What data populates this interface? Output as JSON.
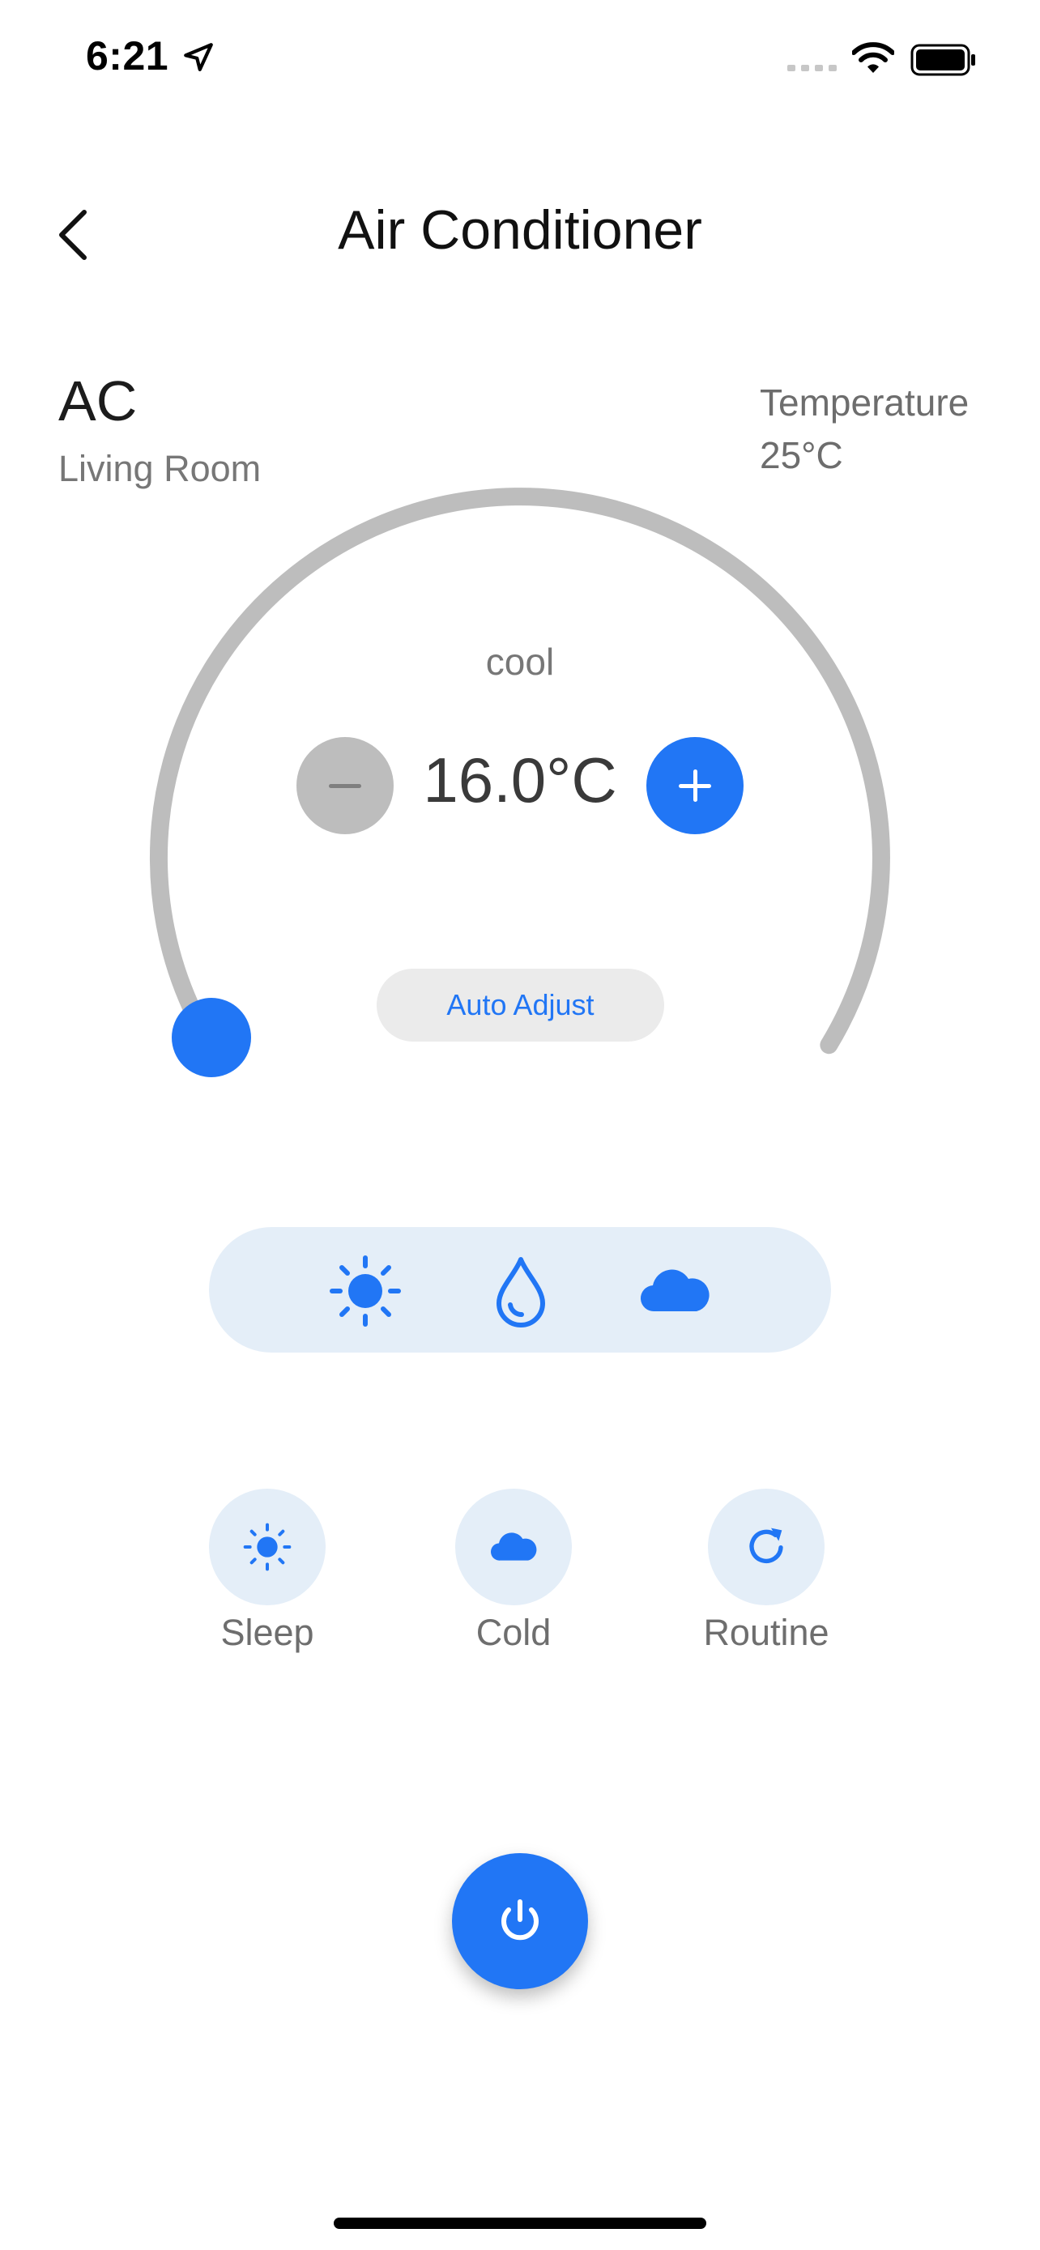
{
  "status_bar": {
    "time": "6:21",
    "icons": [
      "location-arrow-icon",
      "cellular-signal-icon",
      "wifi-icon",
      "battery-icon"
    ]
  },
  "header": {
    "title": "Air Conditioner",
    "back_icon": "chevron-left-icon"
  },
  "device": {
    "name": "AC",
    "room": "Living Room",
    "temperature_label": "Temperature",
    "temperature_value": "25°C"
  },
  "control": {
    "mode": "cool",
    "set_temperature": "16.0°C",
    "dial_level": 0,
    "auto_adjust_label": "Auto Adjust"
  },
  "modes": [
    {
      "icon": "sun-icon"
    },
    {
      "icon": "water-drop-icon"
    },
    {
      "icon": "cloud-icon"
    }
  ],
  "quick_actions": [
    {
      "label": "Sleep",
      "icon": "sun-icon"
    },
    {
      "label": "Cold",
      "icon": "cloud-icon"
    },
    {
      "label": "Routine",
      "icon": "refresh-icon"
    }
  ],
  "power": {
    "icon": "power-icon"
  },
  "colors": {
    "accent": "#2176f5",
    "track": "#bdbdbd",
    "pill_bg": "#e4eef8",
    "text_muted": "#777777"
  }
}
